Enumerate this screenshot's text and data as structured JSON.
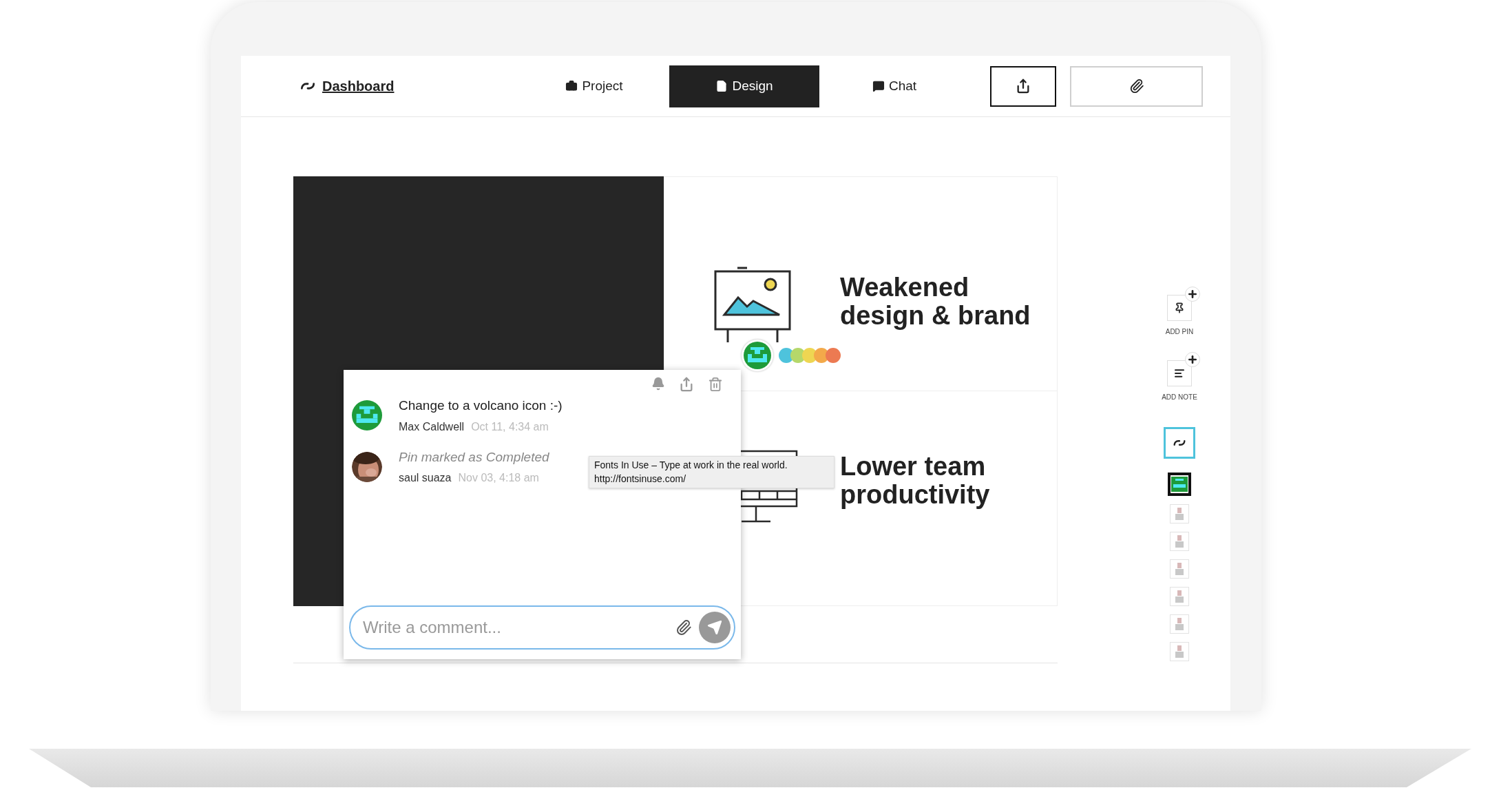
{
  "nav": {
    "dashboard": "Dashboard",
    "tabs": [
      {
        "label": "Project",
        "selected": false
      },
      {
        "label": "Design",
        "selected": true
      },
      {
        "label": "Chat",
        "selected": false
      }
    ]
  },
  "slide": {
    "rows": [
      {
        "heading": "Weakened design & brand"
      },
      {
        "heading": "Lower team productivity"
      }
    ],
    "pin_dots": [
      {
        "color": "#4ec3dc"
      },
      {
        "color": "#b5d86a"
      },
      {
        "color": "#eed652"
      },
      {
        "color": "#f3a94a"
      },
      {
        "color": "#ec7a52"
      }
    ]
  },
  "comments": [
    {
      "kind": "comment",
      "text": "Change to a volcano icon :-)",
      "author": "Max Caldwell",
      "time": "Oct 11, 4:34 am"
    },
    {
      "kind": "status",
      "text": "Pin marked as Completed",
      "author": "saul suaza",
      "time": "Nov 03, 4:18 am"
    }
  ],
  "comment_input": {
    "placeholder": "Write a comment..."
  },
  "tooltip": {
    "title": "Fonts In Use – Type at work in the real world.",
    "url": "http://fontsinuse.com/"
  },
  "toolbar": {
    "tools": [
      {
        "label": "ADD PIN"
      },
      {
        "label": "ADD NOTE"
      }
    ],
    "people": [
      {
        "selected": true
      },
      {
        "selected": false
      },
      {
        "selected": false
      },
      {
        "selected": false
      },
      {
        "selected": false
      },
      {
        "selected": false
      },
      {
        "selected": false
      }
    ]
  }
}
